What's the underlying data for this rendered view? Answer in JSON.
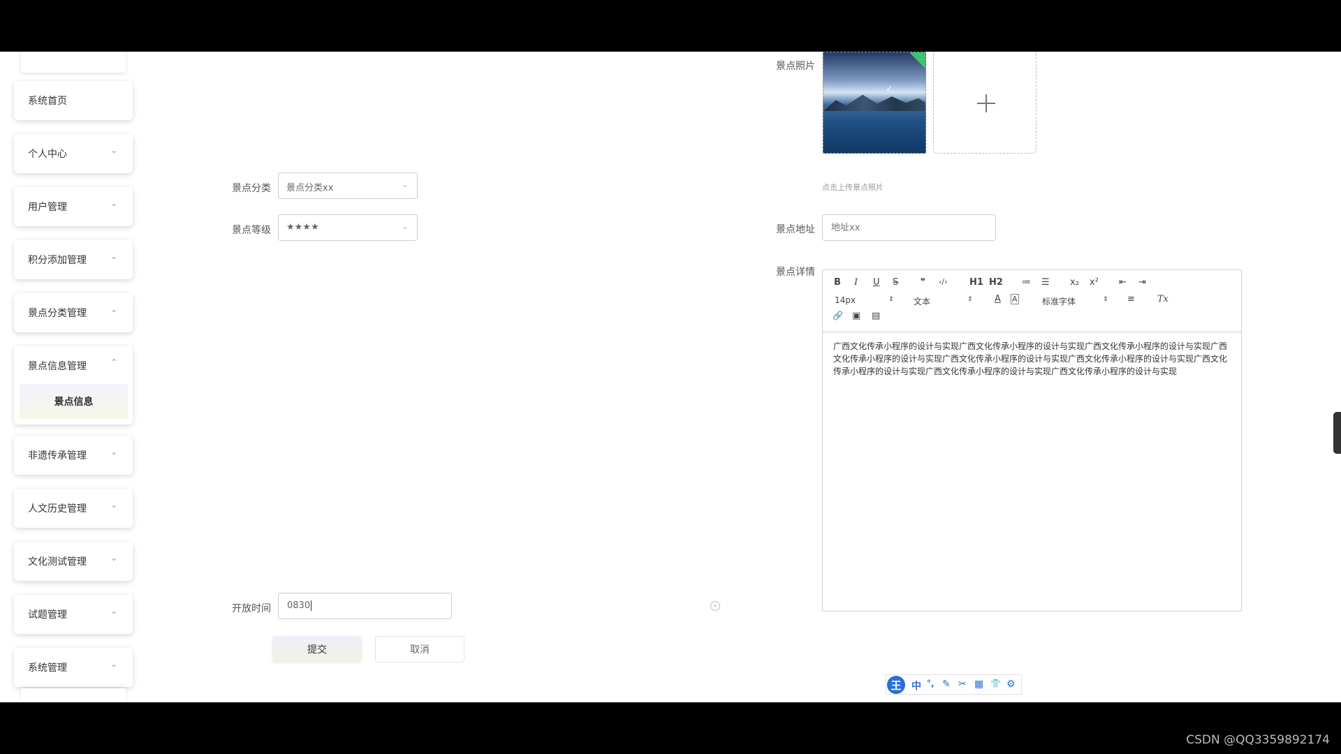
{
  "sidebar": {
    "items": [
      {
        "label": "系统首页",
        "chevron": ""
      },
      {
        "label": "个人中心",
        "chevron": "⌄"
      },
      {
        "label": "用户管理",
        "chevron": "⌄"
      },
      {
        "label": "积分添加管理",
        "chevron": "⌄"
      },
      {
        "label": "景点分类管理",
        "chevron": "⌄"
      },
      {
        "label": "景点信息管理",
        "chevron": "⌃"
      },
      {
        "label": "非遗传承管理",
        "chevron": "⌄"
      },
      {
        "label": "人文历史管理",
        "chevron": "⌄"
      },
      {
        "label": "文化测试管理",
        "chevron": "⌄"
      },
      {
        "label": "试题管理",
        "chevron": "⌄"
      },
      {
        "label": "系统管理",
        "chevron": "⌄"
      }
    ],
    "active_sub": "景点信息"
  },
  "form": {
    "category": {
      "label": "景点分类",
      "value": "景点分类xx"
    },
    "level": {
      "label": "景点等级",
      "value": "★★★★"
    },
    "open_time": {
      "label": "开放时间",
      "value": "0830"
    },
    "photo": {
      "label": "景点照片",
      "hint": "点击上传景点照片"
    },
    "address": {
      "label": "景点地址",
      "placeholder": "地址xx"
    },
    "detail": {
      "label": "景点详情",
      "content": "广西文化传承小程序的设计与实现广西文化传承小程序的设计与实现广西文化传承小程序的设计与实现广西文化传承小程序的设计与实现广西文化传承小程序的设计与实现广西文化传承小程序的设计与实现广西文化传承小程序的设计与实现广西文化传承小程序的设计与实现广西文化传承小程序的设计与实现"
    },
    "submit_label": "提交",
    "cancel_label": "取消"
  },
  "editor_toolbar": {
    "row1": [
      "B",
      "I",
      "U",
      "S",
      "❞",
      "‹/›",
      "H1",
      "H2",
      "≔",
      "☰",
      "x₂",
      "x²",
      "⇤",
      "⇥"
    ],
    "size": "14px",
    "header": "文本",
    "font": "标准字体",
    "row2_icons": [
      "A",
      "A",
      "≡",
      "Tx"
    ],
    "row3": [
      "🔗",
      "▣",
      "▤"
    ]
  },
  "ime": {
    "logo": "王",
    "items": [
      "中",
      "°,",
      "✎",
      "✂",
      "▦",
      "👕",
      "⚙"
    ]
  },
  "watermark": "CSDN @QQ3359892174"
}
